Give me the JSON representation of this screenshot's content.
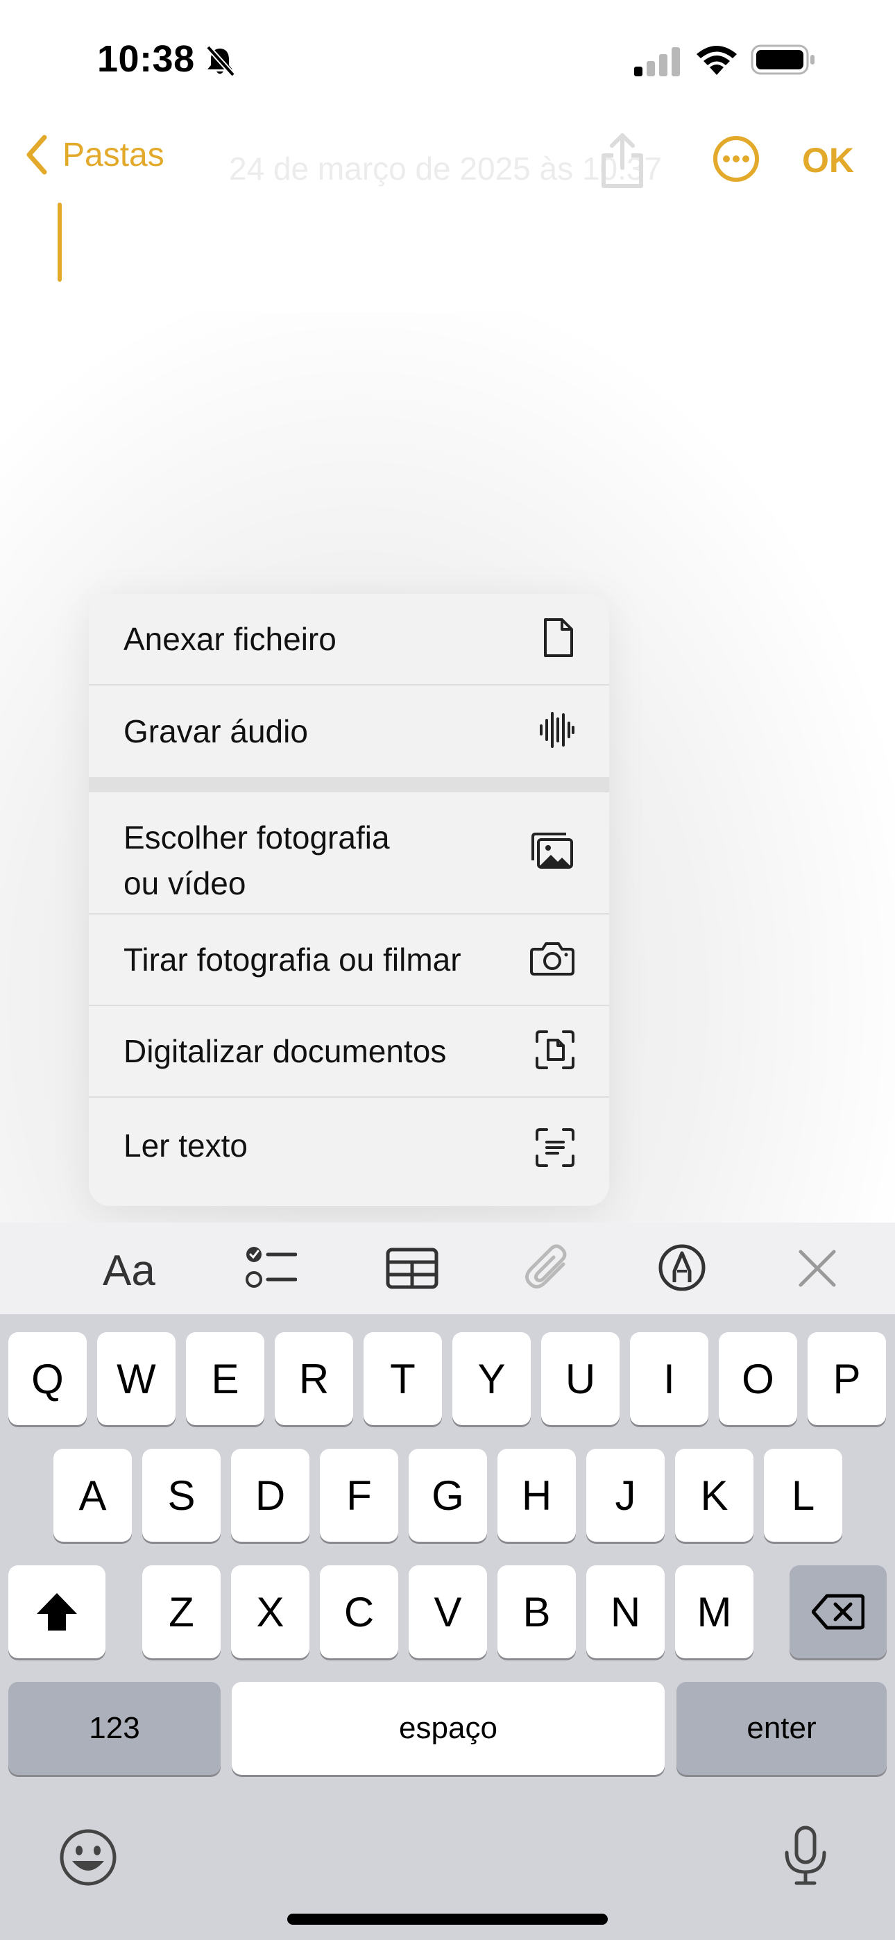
{
  "status_bar": {
    "time": "10:38",
    "icons": [
      "bell-slash-icon",
      "cellular-signal-icon",
      "wifi-icon",
      "battery-icon"
    ]
  },
  "nav": {
    "back_label": "Pastas",
    "date_label": "24 de março de 2025 às 10:37",
    "ok_label": "OK"
  },
  "colors": {
    "accent": "#E2A92A",
    "menu_bg": "#f2f2f2",
    "keyboard_bg": "#d1d3d9"
  },
  "menu": {
    "items": [
      {
        "label": "Anexar ficheiro",
        "icon": "document-icon"
      },
      {
        "label": "Gravar áudio",
        "icon": "waveform-icon"
      },
      {
        "label": "Escolher fotografia\nou vídeo",
        "icon": "photo-library-icon"
      },
      {
        "label": "Tirar fotografia ou filmar",
        "icon": "camera-icon"
      },
      {
        "label": "Digitalizar documentos",
        "icon": "scan-document-icon"
      },
      {
        "label": "Ler texto",
        "icon": "text-scan-icon"
      }
    ]
  },
  "toolbar": {
    "format_label": "Aa",
    "icons": [
      "checklist-icon",
      "table-icon",
      "paperclip-icon",
      "markup-pen-icon",
      "close-icon"
    ]
  },
  "keyboard": {
    "row1": [
      "Q",
      "W",
      "E",
      "R",
      "T",
      "Y",
      "U",
      "I",
      "O",
      "P"
    ],
    "row2": [
      "A",
      "S",
      "D",
      "F",
      "G",
      "H",
      "J",
      "K",
      "L"
    ],
    "row3": [
      "Z",
      "X",
      "C",
      "V",
      "B",
      "N",
      "M"
    ],
    "numbers_label": "123",
    "space_label": "espaço",
    "enter_label": "enter"
  }
}
